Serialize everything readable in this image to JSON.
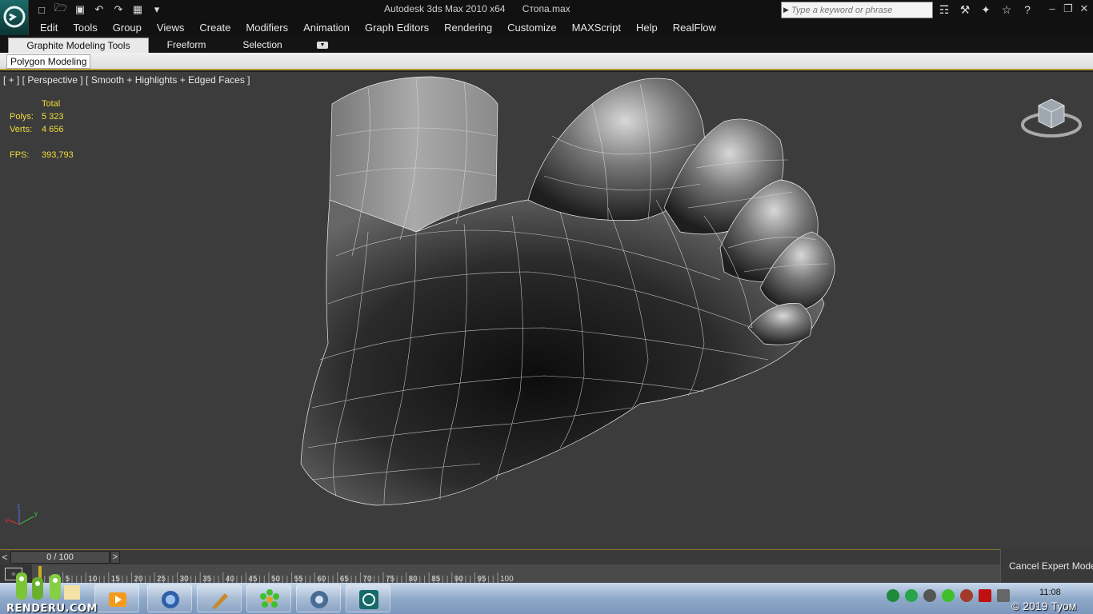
{
  "window": {
    "app_title": "Autodesk 3ds Max  2010 x64",
    "file_name": "Стопа.max"
  },
  "quick_access": [
    "new-icon",
    "open-icon",
    "save-icon",
    "undo-icon",
    "redo-icon",
    "project-folder-icon",
    "dropdown-icon"
  ],
  "search": {
    "placeholder": "Type a keyword or phrase"
  },
  "info_tools": [
    "binoculars-icon",
    "wrench-icon",
    "satellite-icon",
    "star-icon",
    "help-icon"
  ],
  "menu": {
    "items": [
      "Edit",
      "Tools",
      "Group",
      "Views",
      "Create",
      "Modifiers",
      "Animation",
      "Graph Editors",
      "Rendering",
      "Customize",
      "MAXScript",
      "Help",
      "RealFlow"
    ]
  },
  "ribbon": {
    "tabs": [
      "Graphite Modeling Tools",
      "Freeform",
      "Selection"
    ],
    "active_tab": "Graphite Modeling Tools",
    "panel_label": "Polygon Modeling"
  },
  "viewport": {
    "label": "[ + ] [ Perspective ] [ Smooth + Highlights + Edged Faces ]",
    "stats": {
      "header": "Total",
      "polys_label": "Polys:",
      "polys_value": "5 323",
      "verts_label": "Verts:",
      "verts_value": "4 656",
      "fps_label": "FPS:",
      "fps_value": "393,793"
    },
    "tripod": {
      "x": "x",
      "y": "y",
      "z": "z"
    }
  },
  "time_slider": {
    "prev": "<",
    "position": "0 / 100",
    "next": ">"
  },
  "trackbar": {
    "ticks": [
      "5",
      "10",
      "15",
      "20",
      "25",
      "30",
      "35",
      "40",
      "45",
      "50",
      "55",
      "60",
      "65",
      "70",
      "75",
      "80",
      "85",
      "90",
      "95",
      "100"
    ]
  },
  "expert_mode": {
    "label": "Cancel Expert Mode"
  },
  "taskbar": {
    "apps": [
      "media-player-icon",
      "browser-icon",
      "pen-tool-icon",
      "icq-flower-icon",
      "chrome-icon",
      "3dsmax-icon"
    ],
    "clock": "11:08"
  },
  "watermark": {
    "site": "RENDERU.COM",
    "copyright": "© 2019 Туом"
  },
  "colors": {
    "stats_text": "#f2dc3c",
    "viewport_bg": "#3c3c3c",
    "ribbon_accent": "#b59b3c"
  }
}
